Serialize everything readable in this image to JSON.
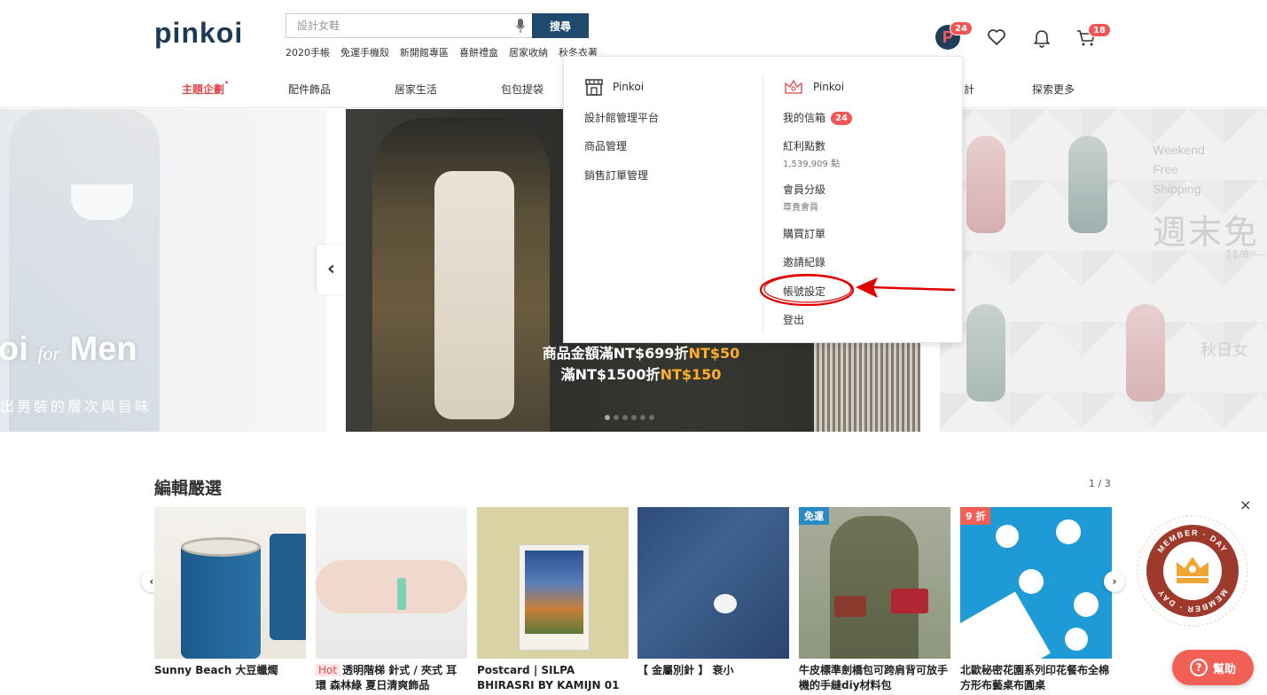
{
  "header": {
    "logo": "pinkoi",
    "search_placeholder": "設計女鞋",
    "search_button": "搜尋",
    "hot_keywords": [
      "2020手帳",
      "免運手機殼",
      "新開館專區",
      "喜餅禮盒",
      "居家收納",
      "秋冬衣著"
    ],
    "avatar_letter": "P",
    "notification_count": "24",
    "cart_count": "18",
    "icons": [
      "pinkoi-p-icon",
      "heart-icon",
      "bell-icon",
      "cart-icon"
    ]
  },
  "category_nav": {
    "items": [
      {
        "label": "主題企劃",
        "active": true
      },
      {
        "label": "配件飾品"
      },
      {
        "label": "居家生活"
      },
      {
        "label": "包包提袋"
      },
      {
        "label": "計"
      },
      {
        "label": "探索更多"
      }
    ]
  },
  "banners": {
    "left": {
      "headline_prefix": "oi",
      "headline_for": "for",
      "headline_suffix": "Men",
      "sub": "出男裝的層次與旨味"
    },
    "main": {
      "promo_line1_text": "商品金額滿NT$699折",
      "promo_line1_hl": "NT$50",
      "promo_line2_text": "滿NT$1500折",
      "promo_line2_hl": "NT$150",
      "slide_count": 6
    },
    "right": {
      "en_line1": "Weekend",
      "en_line2": "Free",
      "en_line3": "Shipping",
      "zh": "週末免",
      "date": "11/8 —",
      "autumn": "秋日女"
    }
  },
  "account_menu": {
    "shop_header": "Pinkoi",
    "shop_items": [
      "設計館管理平台",
      "商品管理",
      "銷售訂單管理"
    ],
    "user_header": "Pinkoi",
    "user_items": [
      {
        "label": "我的信箱",
        "badge": "24"
      },
      {
        "label": "紅利點數",
        "sub": "1,539,909 點"
      },
      {
        "label": "會員分級",
        "sub": "尊貴會員"
      },
      {
        "label": "購買訂單"
      },
      {
        "label": "邀請紀錄"
      },
      {
        "label": "帳號設定"
      },
      {
        "label": "登出"
      }
    ]
  },
  "editor_picks": {
    "title": "編輯嚴選",
    "pager": "1 / 3",
    "cards": [
      {
        "title": "Sunny Beach 大豆蠟燭"
      },
      {
        "hot": "Hot",
        "title": "透明階梯 針式 / 夾式 耳環 森林綠 夏日清爽飾品"
      },
      {
        "title": "Postcard | SILPA BHIRASRI BY KAMIJN 01"
      },
      {
        "title": "【 金屬別針 】 衰小"
      },
      {
        "tag": "免運",
        "title": "牛皮標準劍橋包可跨肩背可放手機的手縫diy材料包"
      },
      {
        "tag": "9 折",
        "title": "北歐秘密花園系列印花餐布全棉方形布藝桌布圓桌"
      }
    ]
  },
  "floating": {
    "member_badge_top": "MEMBER · DAY",
    "member_badge_bottom": "MEMBER · DAY",
    "help_label": "幫助",
    "help_icon": "?",
    "close": "×"
  },
  "colors": {
    "brand_navy": "#1f4a6b",
    "accent_red": "#e24a4a",
    "badge_red": "#f25555",
    "promo_orange": "#ffae2a",
    "annotation_red": "#e00000"
  }
}
